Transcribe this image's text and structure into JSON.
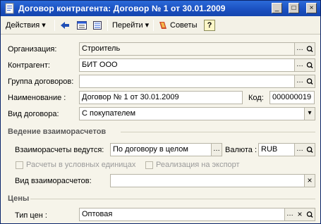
{
  "window": {
    "title": "Договор контрагента: Договор № 1 от 30.01.2009"
  },
  "toolbar": {
    "actions": "Действия",
    "goto": "Перейти",
    "tips": "Советы",
    "help": "?"
  },
  "form": {
    "organization": {
      "label": "Организация:",
      "value": "Строитель"
    },
    "counterparty": {
      "label": "Контрагент:",
      "value": "БИТ ООО"
    },
    "contract_group": {
      "label": "Группа договоров:",
      "value": ""
    },
    "name": {
      "label": "Наименование :",
      "value": "Договор № 1 от 30.01.2009"
    },
    "code": {
      "label": "Код:",
      "value": "000000019"
    },
    "contract_type": {
      "label": "Вид договора:",
      "value": "С покупателем"
    }
  },
  "settlements": {
    "section": "Ведение взаиморасчетов",
    "conducted": {
      "label": "Взаиморасчеты ведутся:",
      "value": "По договору в целом"
    },
    "currency": {
      "label": "Валюта :",
      "value": "RUB"
    },
    "conditional_units": "Расчеты в условных единицах",
    "export": "Реализация на экспорт",
    "kind": {
      "label": "Вид взаиморасчетов:",
      "value": ""
    }
  },
  "prices": {
    "section": "Цены",
    "price_type": {
      "label": "Тип цен :",
      "value": "Оптовая"
    }
  }
}
